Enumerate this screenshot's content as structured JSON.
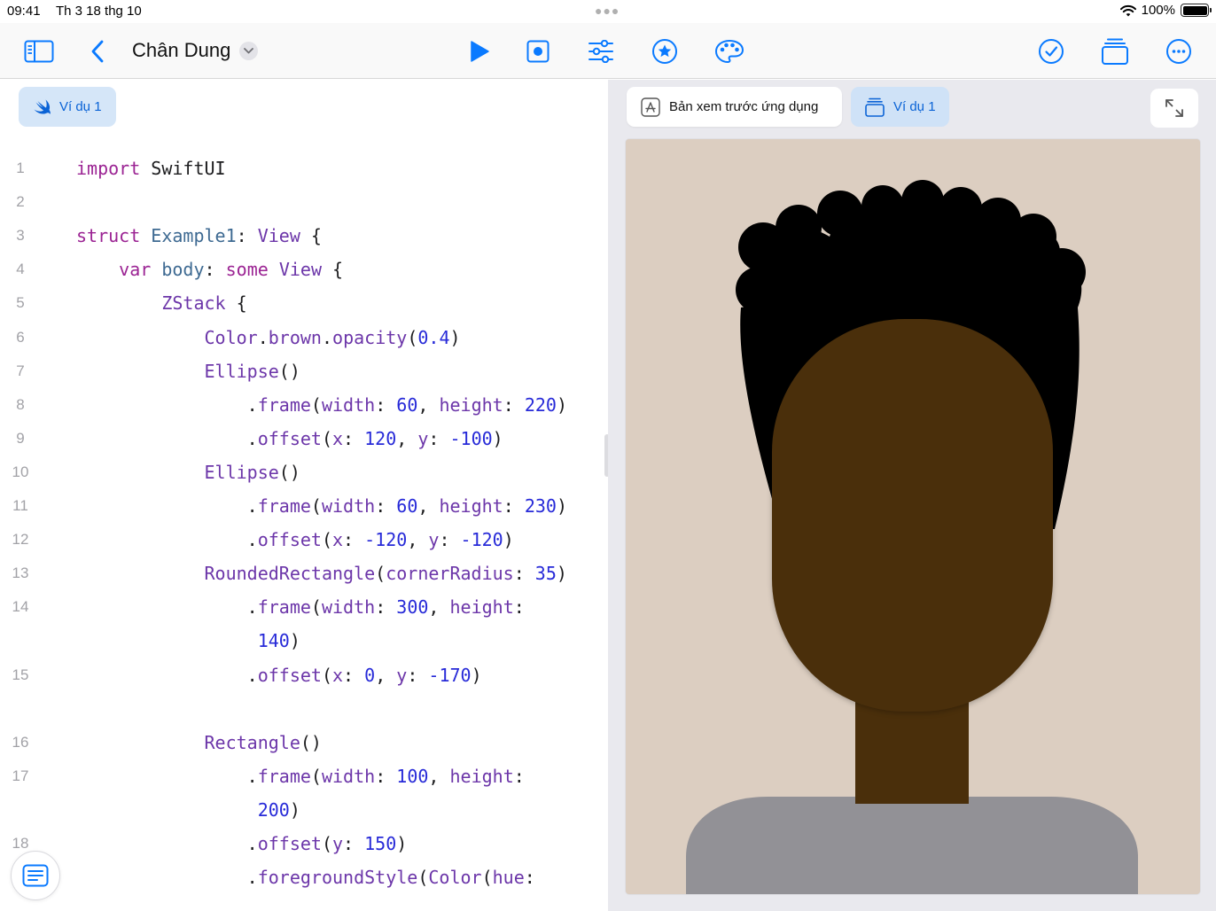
{
  "status_bar": {
    "time": "09:41",
    "date": "Th 3 18 thg 10",
    "battery": "100%"
  },
  "toolbar": {
    "title": "Chân Dung",
    "accent_color": "#0a7aff",
    "icons": [
      "sidebar-icon",
      "back-chevron-icon",
      "title-chevron-icon",
      "run-icon",
      "record-icon",
      "sliders-icon",
      "star-icon",
      "palette-icon",
      "checkmark-icon",
      "stack-icon",
      "more-icon"
    ]
  },
  "editor": {
    "example_chip": "Ví dụ 1",
    "lines": [
      {
        "num": "1",
        "tokens": [
          {
            "t": "import",
            "c": "kw"
          },
          {
            "t": " SwiftUI",
            "c": "pl"
          }
        ]
      },
      {
        "num": "2",
        "tokens": []
      },
      {
        "num": "3",
        "tokens": [
          {
            "t": "struct",
            "c": "kw"
          },
          {
            "t": " Example1",
            "c": "ty"
          },
          {
            "t": ": ",
            "c": "pl"
          },
          {
            "t": "View",
            "c": "fn"
          },
          {
            "t": " {",
            "c": "pl"
          }
        ]
      },
      {
        "num": "4",
        "indent": "    ",
        "tokens": [
          {
            "t": "var",
            "c": "kw"
          },
          {
            "t": " body",
            "c": "ty"
          },
          {
            "t": ": ",
            "c": "pl"
          },
          {
            "t": "some",
            "c": "kw"
          },
          {
            "t": " View",
            "c": "fn"
          },
          {
            "t": " {",
            "c": "pl"
          }
        ]
      },
      {
        "num": "5",
        "indent": "        ",
        "tokens": [
          {
            "t": "ZStack",
            "c": "fn"
          },
          {
            "t": " {",
            "c": "pl"
          }
        ]
      },
      {
        "num": "6",
        "indent": "            ",
        "tokens": [
          {
            "t": "Color",
            "c": "fn"
          },
          {
            "t": ".",
            "c": "pl"
          },
          {
            "t": "brown",
            "c": "fn"
          },
          {
            "t": ".",
            "c": "pl"
          },
          {
            "t": "opacity",
            "c": "fn"
          },
          {
            "t": "(",
            "c": "pl"
          },
          {
            "t": "0.4",
            "c": "nm"
          },
          {
            "t": ")",
            "c": "pl"
          }
        ]
      },
      {
        "num": "7",
        "indent": "            ",
        "tokens": [
          {
            "t": "Ellipse",
            "c": "fn"
          },
          {
            "t": "()",
            "c": "pl"
          }
        ]
      },
      {
        "num": "8",
        "indent": "                ",
        "tokens": [
          {
            "t": ".",
            "c": "pl"
          },
          {
            "t": "frame",
            "c": "fn"
          },
          {
            "t": "(",
            "c": "pl"
          },
          {
            "t": "width",
            "c": "fn"
          },
          {
            "t": ": ",
            "c": "pl"
          },
          {
            "t": "60",
            "c": "nm"
          },
          {
            "t": ", ",
            "c": "pl"
          },
          {
            "t": "height",
            "c": "fn"
          },
          {
            "t": ": ",
            "c": "pl"
          },
          {
            "t": "220",
            "c": "nm"
          },
          {
            "t": ")",
            "c": "pl"
          }
        ]
      },
      {
        "num": "9",
        "indent": "                ",
        "tokens": [
          {
            "t": ".",
            "c": "pl"
          },
          {
            "t": "offset",
            "c": "fn"
          },
          {
            "t": "(",
            "c": "pl"
          },
          {
            "t": "x",
            "c": "fn"
          },
          {
            "t": ": ",
            "c": "pl"
          },
          {
            "t": "120",
            "c": "nm"
          },
          {
            "t": ", ",
            "c": "pl"
          },
          {
            "t": "y",
            "c": "fn"
          },
          {
            "t": ": ",
            "c": "pl"
          },
          {
            "t": "-100",
            "c": "nm"
          },
          {
            "t": ")",
            "c": "pl"
          }
        ]
      },
      {
        "num": "10",
        "indent": "            ",
        "tokens": [
          {
            "t": "Ellipse",
            "c": "fn"
          },
          {
            "t": "()",
            "c": "pl"
          }
        ]
      },
      {
        "num": "11",
        "indent": "                ",
        "tokens": [
          {
            "t": ".",
            "c": "pl"
          },
          {
            "t": "frame",
            "c": "fn"
          },
          {
            "t": "(",
            "c": "pl"
          },
          {
            "t": "width",
            "c": "fn"
          },
          {
            "t": ": ",
            "c": "pl"
          },
          {
            "t": "60",
            "c": "nm"
          },
          {
            "t": ", ",
            "c": "pl"
          },
          {
            "t": "height",
            "c": "fn"
          },
          {
            "t": ": ",
            "c": "pl"
          },
          {
            "t": "230",
            "c": "nm"
          },
          {
            "t": ")",
            "c": "pl"
          }
        ]
      },
      {
        "num": "12",
        "indent": "                ",
        "tokens": [
          {
            "t": ".",
            "c": "pl"
          },
          {
            "t": "offset",
            "c": "fn"
          },
          {
            "t": "(",
            "c": "pl"
          },
          {
            "t": "x",
            "c": "fn"
          },
          {
            "t": ": ",
            "c": "pl"
          },
          {
            "t": "-120",
            "c": "nm"
          },
          {
            "t": ", ",
            "c": "pl"
          },
          {
            "t": "y",
            "c": "fn"
          },
          {
            "t": ": ",
            "c": "pl"
          },
          {
            "t": "-120",
            "c": "nm"
          },
          {
            "t": ")",
            "c": "pl"
          }
        ]
      },
      {
        "num": "13",
        "indent": "            ",
        "tokens": [
          {
            "t": "RoundedRectangle",
            "c": "fn"
          },
          {
            "t": "(",
            "c": "pl"
          },
          {
            "t": "cornerRadius",
            "c": "fn"
          },
          {
            "t": ": ",
            "c": "pl"
          },
          {
            "t": "35",
            "c": "nm"
          },
          {
            "t": ")",
            "c": "pl"
          }
        ]
      },
      {
        "num": "14",
        "indent": "                ",
        "tokens": [
          {
            "t": ".",
            "c": "pl"
          },
          {
            "t": "frame",
            "c": "fn"
          },
          {
            "t": "(",
            "c": "pl"
          },
          {
            "t": "width",
            "c": "fn"
          },
          {
            "t": ": ",
            "c": "pl"
          },
          {
            "t": "300",
            "c": "nm"
          },
          {
            "t": ", ",
            "c": "pl"
          },
          {
            "t": "height",
            "c": "fn"
          },
          {
            "t": ":",
            "c": "pl"
          }
        ]
      },
      {
        "num": "",
        "indent": "                 ",
        "tokens": [
          {
            "t": "140",
            "c": "nm"
          },
          {
            "t": ")",
            "c": "pl"
          }
        ]
      },
      {
        "num": "15",
        "indent": "                ",
        "tokens": [
          {
            "t": ".",
            "c": "pl"
          },
          {
            "t": "offset",
            "c": "fn"
          },
          {
            "t": "(",
            "c": "pl"
          },
          {
            "t": "x",
            "c": "fn"
          },
          {
            "t": ": ",
            "c": "pl"
          },
          {
            "t": "0",
            "c": "nm"
          },
          {
            "t": ", ",
            "c": "pl"
          },
          {
            "t": "y",
            "c": "fn"
          },
          {
            "t": ": ",
            "c": "pl"
          },
          {
            "t": "-170",
            "c": "nm"
          },
          {
            "t": ")",
            "c": "pl"
          }
        ]
      },
      {
        "num": "",
        "tokens": []
      },
      {
        "num": "16",
        "indent": "            ",
        "tokens": [
          {
            "t": "Rectangle",
            "c": "fn"
          },
          {
            "t": "()",
            "c": "pl"
          }
        ]
      },
      {
        "num": "17",
        "indent": "                ",
        "tokens": [
          {
            "t": ".",
            "c": "pl"
          },
          {
            "t": "frame",
            "c": "fn"
          },
          {
            "t": "(",
            "c": "pl"
          },
          {
            "t": "width",
            "c": "fn"
          },
          {
            "t": ": ",
            "c": "pl"
          },
          {
            "t": "100",
            "c": "nm"
          },
          {
            "t": ", ",
            "c": "pl"
          },
          {
            "t": "height",
            "c": "fn"
          },
          {
            "t": ":",
            "c": "pl"
          }
        ]
      },
      {
        "num": "",
        "indent": "                 ",
        "tokens": [
          {
            "t": "200",
            "c": "nm"
          },
          {
            "t": ")",
            "c": "pl"
          }
        ]
      },
      {
        "num": "18",
        "indent": "                ",
        "tokens": [
          {
            "t": ".",
            "c": "pl"
          },
          {
            "t": "offset",
            "c": "fn"
          },
          {
            "t": "(",
            "c": "pl"
          },
          {
            "t": "y",
            "c": "fn"
          },
          {
            "t": ": ",
            "c": "pl"
          },
          {
            "t": "150",
            "c": "nm"
          },
          {
            "t": ")",
            "c": "pl"
          }
        ]
      },
      {
        "num": "",
        "indent": "                ",
        "tokens": [
          {
            "t": ".",
            "c": "pl"
          },
          {
            "t": "foregroundStyle",
            "c": "fn"
          },
          {
            "t": "(",
            "c": "pl"
          },
          {
            "t": "Color",
            "c": "fn"
          },
          {
            "t": "(",
            "c": "pl"
          },
          {
            "t": "hue",
            "c": "fn"
          },
          {
            "t": ":",
            "c": "pl"
          }
        ]
      }
    ]
  },
  "preview": {
    "tab_app_preview": "Bản xem trước ứng dụng",
    "tab_example": "Ví dụ 1",
    "colors": {
      "background": "#dccec1",
      "hair": "#000000",
      "face": "#4a2f0b",
      "neck": "#4a2f0b",
      "shirt": "#929196"
    }
  }
}
